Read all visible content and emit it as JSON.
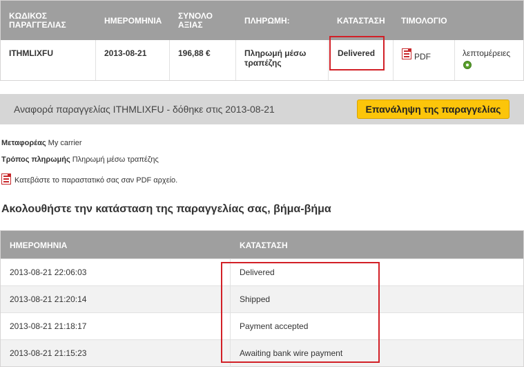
{
  "orders_table": {
    "headers": {
      "reference": "ΚΩΔΙΚΟΣ ΠΑΡΑΓΓΕΛΙΑΣ",
      "reference_line1": "ΚΩΔΙΚΟΣ",
      "reference_line2": "ΠΑΡΑΓΓΕΛΙΑΣ",
      "date": "ΗΜΕΡΟΜΗΝΙΑ",
      "total": "ΣΥΝΟΛΟ ΑΞΙΑΣ",
      "total_line1": "ΣΥΝΟΛΟ",
      "total_line2": "ΑΞΙΑΣ",
      "payment": "ΠΛΗΡΩΜΗ:",
      "status": "ΚΑΤΑΣΤΑΣΗ",
      "invoice": "ΤΙΜΟΛΟΓΙΟ"
    },
    "row": {
      "reference": "ITHMLIXFU",
      "date": "2013-08-21",
      "total": "196,88 €",
      "payment_line1": "Πληρωμή μέσω",
      "payment_line2": "τραπέζης",
      "status": "Delivered",
      "invoice_label": "PDF",
      "invoice_icon": "pdf-icon",
      "details_label": "λεπτομέρειες",
      "reorder_icon": "refresh-icon"
    }
  },
  "order_reference": {
    "text": "Αναφορά παραγγελίας ITHMLIXFU - δόθηκε στις 2013-08-21",
    "reorder_button": "Επανάληψη της παραγγελίας"
  },
  "info": {
    "carrier_label": "Μεταφορέας",
    "carrier_value": "My carrier",
    "payment_label": "Τρόπος πληρωμής",
    "payment_value": "Πληρωμή μέσω τραπέζης",
    "download_text": "Κατεβάστε το παραστατικό σας σαν PDF αρχείο."
  },
  "history": {
    "title": "Ακολουθήστε την κατάσταση της παραγγελίας σας, βήμα-βήμα",
    "headers": {
      "date": "ΗΜΕΡΟΜΗΝΙΑ",
      "status": "ΚΑΤΑΣΤΑΣΗ"
    },
    "rows": [
      {
        "date": "2013-08-21 22:06:03",
        "status": "Delivered"
      },
      {
        "date": "2013-08-21 21:20:14",
        "status": "Shipped"
      },
      {
        "date": "2013-08-21 21:18:17",
        "status": "Payment accepted"
      },
      {
        "date": "2013-08-21 21:15:23",
        "status": "Awaiting bank wire payment"
      }
    ]
  },
  "colors": {
    "header_bg": "#9f9f9f",
    "highlight": "#d21f26",
    "button": "#fcc50a",
    "bar_bg": "#d6d6d6"
  }
}
